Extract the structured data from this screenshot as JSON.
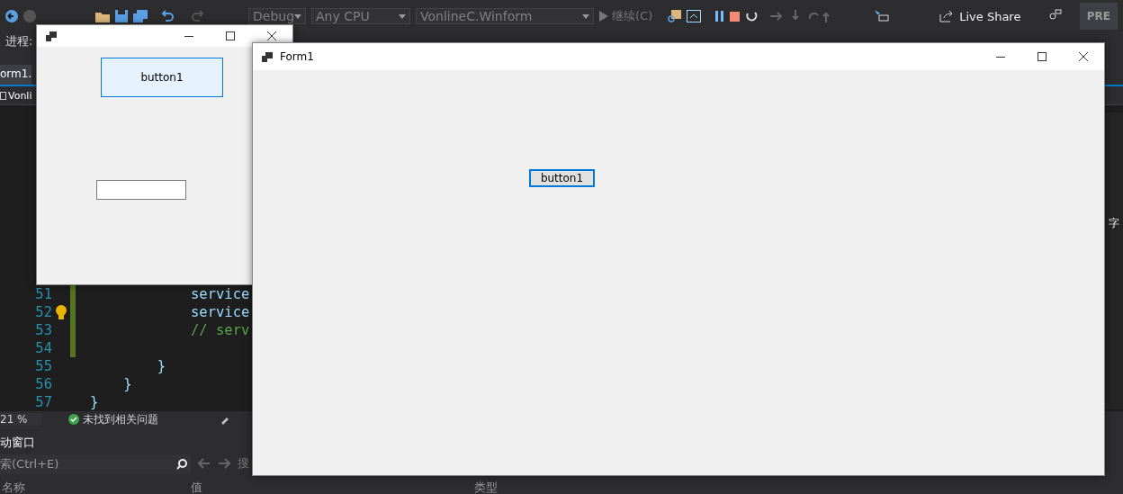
{
  "toolbar": {
    "configuration": "Debug",
    "platform": "Any CPU",
    "project": "VonlineC.Winform",
    "continue": "继续(C)",
    "live_share": "Live Share",
    "cut_button": "PRE"
  },
  "debug_location": {
    "process_label": "进程:"
  },
  "tabs": [
    {
      "label": "orm1.",
      "selected": true
    }
  ],
  "navigation": {
    "project": "Vonli"
  },
  "editor": {
    "lines": [
      {
        "number": "51",
        "code": "            service",
        "changed": true,
        "bulb": false
      },
      {
        "number": "52",
        "code": "            service",
        "changed": true,
        "bulb": true
      },
      {
        "number": "53",
        "code": "            // serv",
        "changed": true,
        "bulb": false
      },
      {
        "number": "54",
        "changed": true,
        "bulb": false
      },
      {
        "number": "55",
        "code": "        }",
        "changed": false,
        "bulb": false
      },
      {
        "number": "56",
        "code": "    }",
        "changed": false,
        "bulb": false
      },
      {
        "number": "57",
        "code": "}",
        "changed": false,
        "bulb": false
      }
    ]
  },
  "side_panel": {
    "text": "字"
  },
  "status": {
    "zoom": "21 %",
    "issues": "未找到相关问题"
  },
  "autos": {
    "title": "动窗口",
    "search_placeholder": "索(Ctrl+E)",
    "search_depth": "搜",
    "columns": [
      "名称",
      "值",
      "类型"
    ]
  },
  "windows": [
    {
      "kind": "designer",
      "button": "button1",
      "button_focused": false,
      "has_textbox": true
    },
    {
      "kind": "form",
      "title": "Form1",
      "button": "button1",
      "button_focused": true,
      "has_textbox": false
    }
  ]
}
